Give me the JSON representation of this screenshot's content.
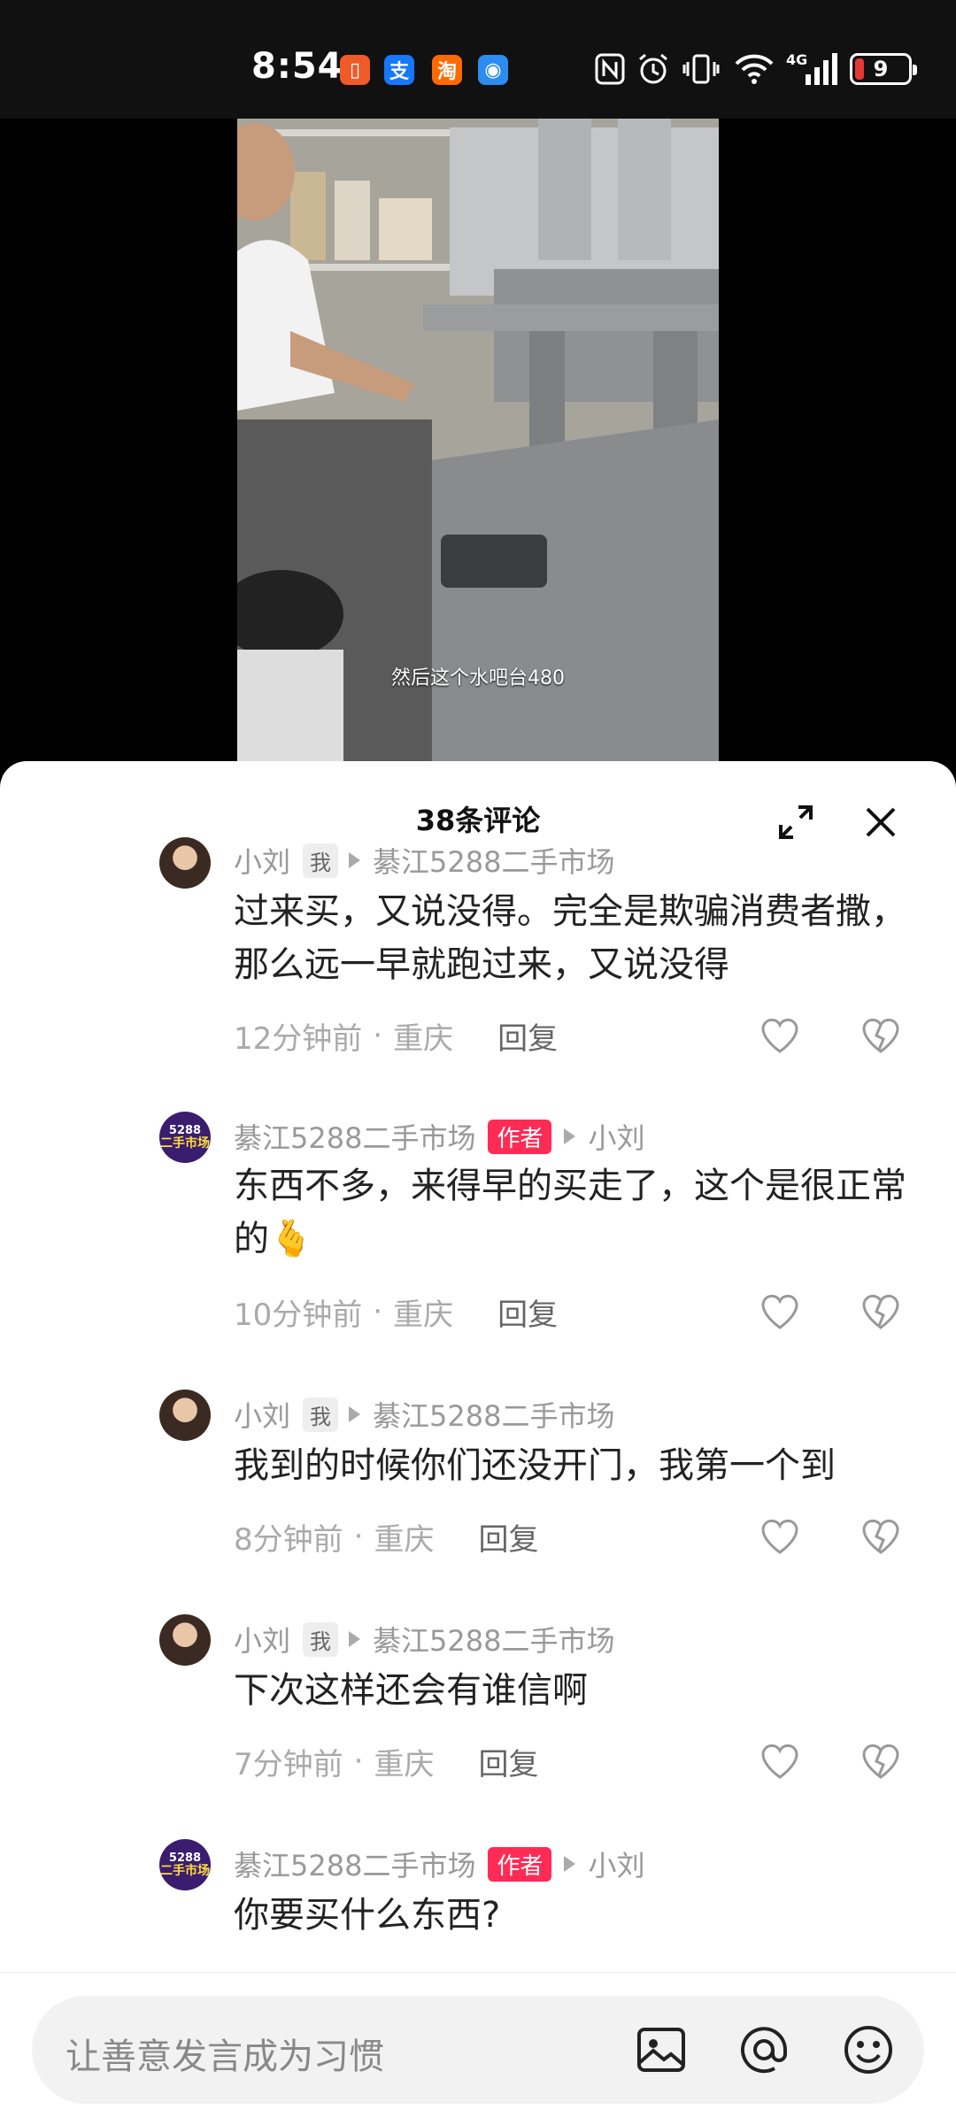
{
  "status_bar": {
    "time": "8:54",
    "app_icons": [
      {
        "name": "app-notification-icon",
        "glyph": "▯",
        "color": "#f05a28"
      },
      {
        "name": "alipay-icon",
        "glyph": "支",
        "color": "#1677ff"
      },
      {
        "name": "taobao-icon",
        "glyph": "淘",
        "color": "#ff6a00"
      },
      {
        "name": "browser-icon",
        "glyph": "◉",
        "color": "#2d8cf0"
      }
    ],
    "network": "4G",
    "battery": "9"
  },
  "video": {
    "subtitle": "然后这个水吧台480"
  },
  "comments_panel": {
    "title": "38条评论",
    "comments": [
      {
        "user": "小刘",
        "badge": "我",
        "reply_to": "綦江5288二手市场",
        "text": "过来买，又说没得。完全是欺骗消费者撒，那么远一早就跑过来，又说没得",
        "time": "12分钟前",
        "location": "重庆",
        "reply_label": "回复",
        "avatar": "girl"
      },
      {
        "user": "綦江5288二手市场",
        "badge": "作者",
        "reply_to": "小刘",
        "text": "东西不多，来得早的买走了，这个是很正常的🫰",
        "time": "10分钟前",
        "location": "重庆",
        "reply_label": "回复",
        "avatar": "shop"
      },
      {
        "user": "小刘",
        "badge": "我",
        "reply_to": "綦江5288二手市场",
        "text": "我到的时候你们还没开门，我第一个到",
        "time": "8分钟前",
        "location": "重庆",
        "reply_label": "回复",
        "avatar": "girl"
      },
      {
        "user": "小刘",
        "badge": "我",
        "reply_to": "綦江5288二手市场",
        "text": "下次这样还会有谁信啊",
        "time": "7分钟前",
        "location": "重庆",
        "reply_label": "回复",
        "avatar": "girl"
      },
      {
        "user": "綦江5288二手市场",
        "badge": "作者",
        "reply_to": "小刘",
        "text": "你要买什么东西?",
        "avatar": "shop"
      }
    ],
    "shop_avatar_text": {
      "line1": "5288",
      "line2": "二手市场"
    }
  },
  "input_bar": {
    "placeholder": "让善意发言成为习惯"
  },
  "colors": {
    "author_badge": "#fe2c55",
    "accent": "#fe2c55"
  }
}
